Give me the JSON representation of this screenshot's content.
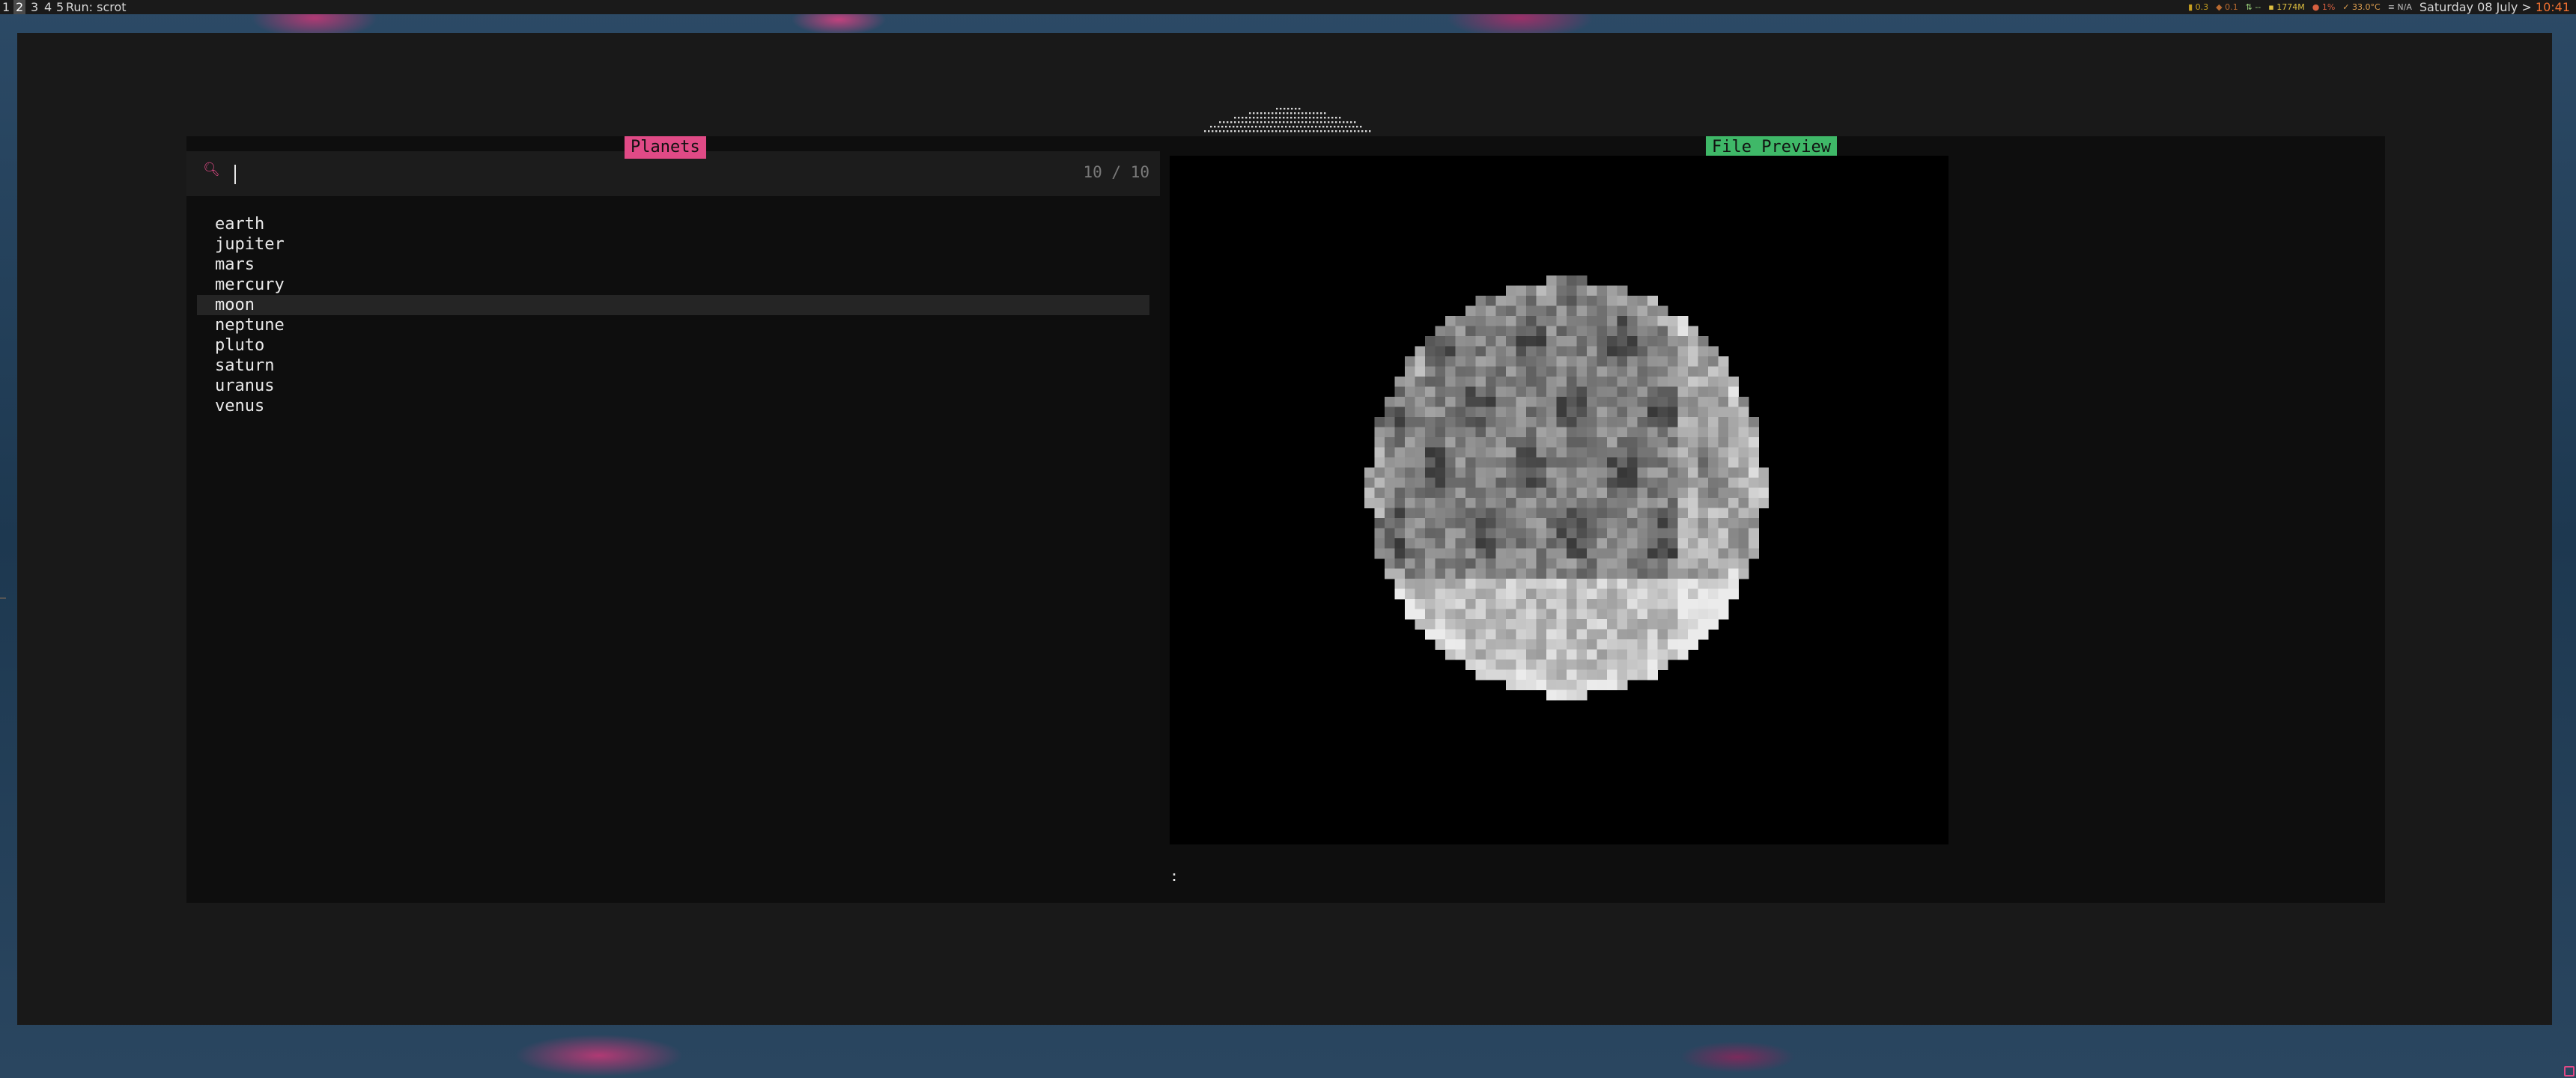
{
  "topbar": {
    "workspaces": [
      "1",
      "2",
      "3",
      "4",
      "5"
    ],
    "active_workspace": "2",
    "run_label": "Run: scrot",
    "status": {
      "cpu": "0.3",
      "load": "0.1",
      "net": "--",
      "mem": "1774M",
      "disk": "1%",
      "temp": "33.0°C",
      "battery": "N/A"
    },
    "date": "Saturday 08 July",
    "separator": ">",
    "time": "10:41"
  },
  "fzf": {
    "list_title": "Planets",
    "preview_title": "File Preview",
    "query": "",
    "match_count": "10 / 10",
    "items": [
      "earth",
      "jupiter",
      "mars",
      "mercury",
      "moon",
      "neptune",
      "pluto",
      "saturn",
      "uranus",
      "venus"
    ],
    "selected_index": 4,
    "preview_prompt": ":"
  },
  "colors": {
    "accent_pink": "#e04a86",
    "accent_green": "#3fb868",
    "time_orange": "#f07030"
  },
  "icons": {
    "search": "magnifier",
    "corner": "app-indicator"
  }
}
